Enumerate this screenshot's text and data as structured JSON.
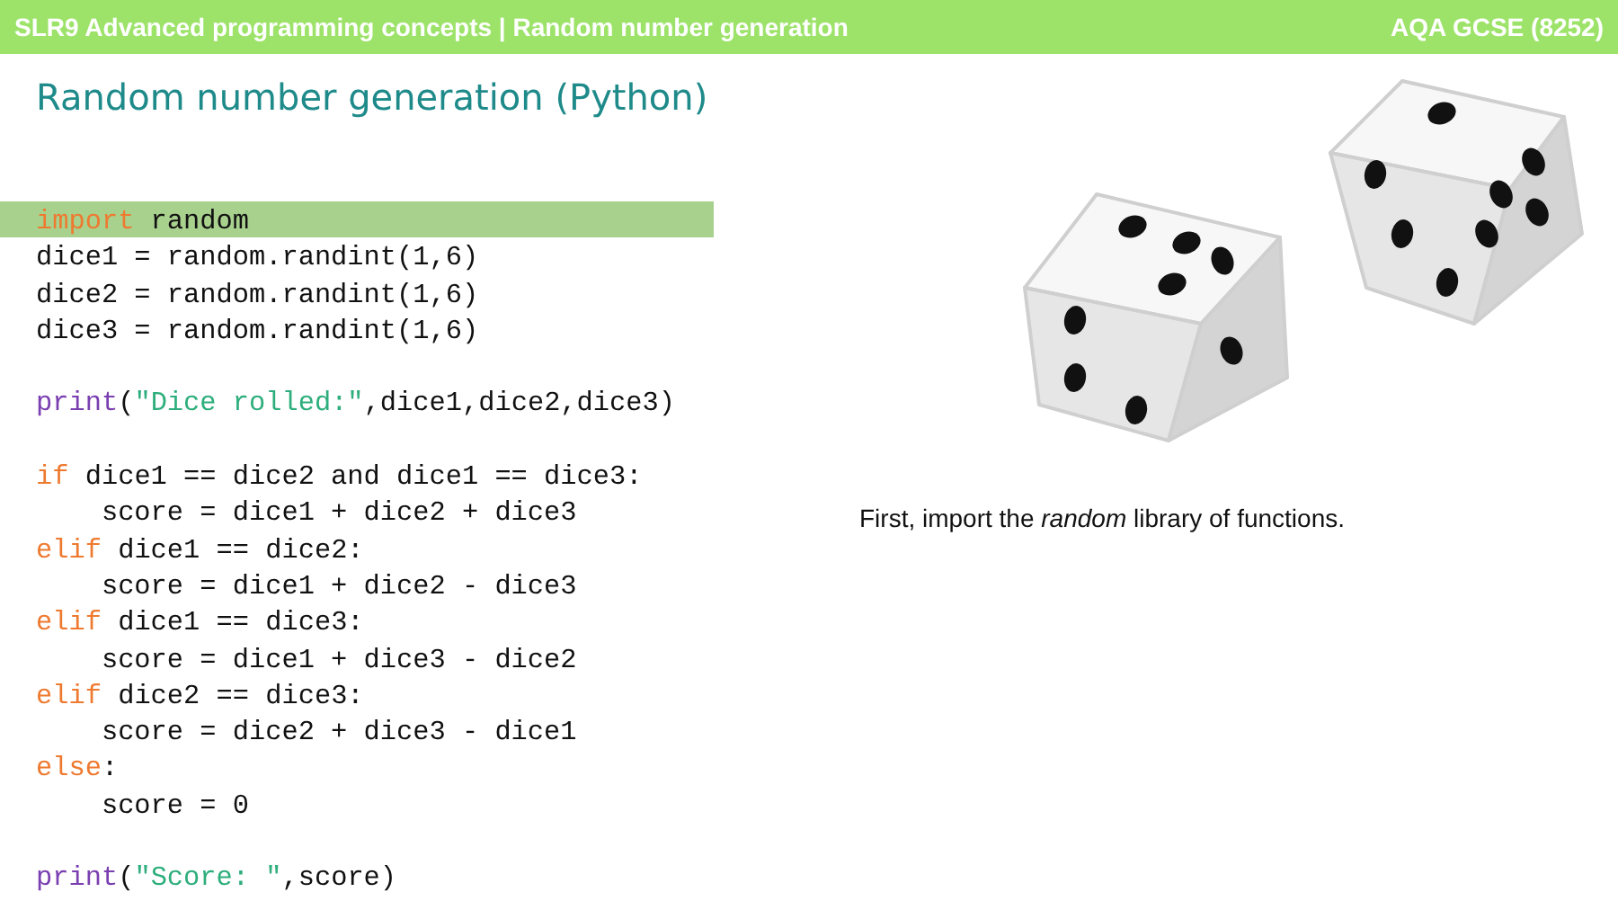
{
  "header": {
    "course": "SLR9 Advanced programming concepts | Random number generation",
    "qualification": "AQA GCSE (8252)"
  },
  "title": "Random number generation (Python)",
  "code_blocks": [
    {
      "lines": [
        {
          "highlighted": true,
          "tokens": [
            {
              "kind": "keyword",
              "text": "import"
            },
            {
              "kind": "plain",
              "text": " random"
            }
          ]
        },
        {
          "highlighted": false,
          "tokens": [
            {
              "kind": "plain",
              "text": "dice1 = random.randint(1,6)"
            }
          ]
        },
        {
          "highlighted": false,
          "tokens": [
            {
              "kind": "plain",
              "text": "dice2 = random.randint(1,6)"
            }
          ]
        },
        {
          "highlighted": false,
          "tokens": [
            {
              "kind": "plain",
              "text": "dice3 = random.randint(1,6)"
            }
          ]
        }
      ]
    },
    {
      "lines": [
        {
          "highlighted": false,
          "tokens": [
            {
              "kind": "builtin",
              "text": "print"
            },
            {
              "kind": "plain",
              "text": "("
            },
            {
              "kind": "string",
              "text": "\"Dice rolled:\""
            },
            {
              "kind": "plain",
              "text": ",dice1,dice2,dice3)"
            }
          ]
        }
      ]
    },
    {
      "lines": [
        {
          "highlighted": false,
          "tokens": [
            {
              "kind": "keyword",
              "text": "if"
            },
            {
              "kind": "plain",
              "text": " dice1 == dice2 and dice1 == dice3:"
            }
          ]
        },
        {
          "highlighted": false,
          "tokens": [
            {
              "kind": "plain",
              "text": "    score = dice1 + dice2 + dice3"
            }
          ]
        },
        {
          "highlighted": false,
          "tokens": [
            {
              "kind": "keyword",
              "text": "elif"
            },
            {
              "kind": "plain",
              "text": " dice1 == dice2:"
            }
          ]
        },
        {
          "highlighted": false,
          "tokens": [
            {
              "kind": "plain",
              "text": "    score = dice1 + dice2 - dice3"
            }
          ]
        },
        {
          "highlighted": false,
          "tokens": [
            {
              "kind": "keyword",
              "text": "elif"
            },
            {
              "kind": "plain",
              "text": " dice1 == dice3:"
            }
          ]
        },
        {
          "highlighted": false,
          "tokens": [
            {
              "kind": "plain",
              "text": "    score = dice1 + dice3 - dice2"
            }
          ]
        },
        {
          "highlighted": false,
          "tokens": [
            {
              "kind": "keyword",
              "text": "elif"
            },
            {
              "kind": "plain",
              "text": " dice2 == dice3:"
            }
          ]
        },
        {
          "highlighted": false,
          "tokens": [
            {
              "kind": "plain",
              "text": "    score = dice2 + dice3 - dice1"
            }
          ]
        },
        {
          "highlighted": false,
          "tokens": [
            {
              "kind": "keyword",
              "text": "else"
            },
            {
              "kind": "plain",
              "text": ":"
            }
          ]
        },
        {
          "highlighted": false,
          "tokens": [
            {
              "kind": "plain",
              "text": "    score = 0"
            }
          ]
        }
      ]
    },
    {
      "lines": [
        {
          "highlighted": false,
          "tokens": [
            {
              "kind": "builtin",
              "text": "print"
            },
            {
              "kind": "plain",
              "text": "("
            },
            {
              "kind": "string",
              "text": "\"Score: \""
            },
            {
              "kind": "plain",
              "text": ",score)"
            }
          ]
        }
      ]
    }
  ],
  "caption": "First, import the *random* library of functions."
}
